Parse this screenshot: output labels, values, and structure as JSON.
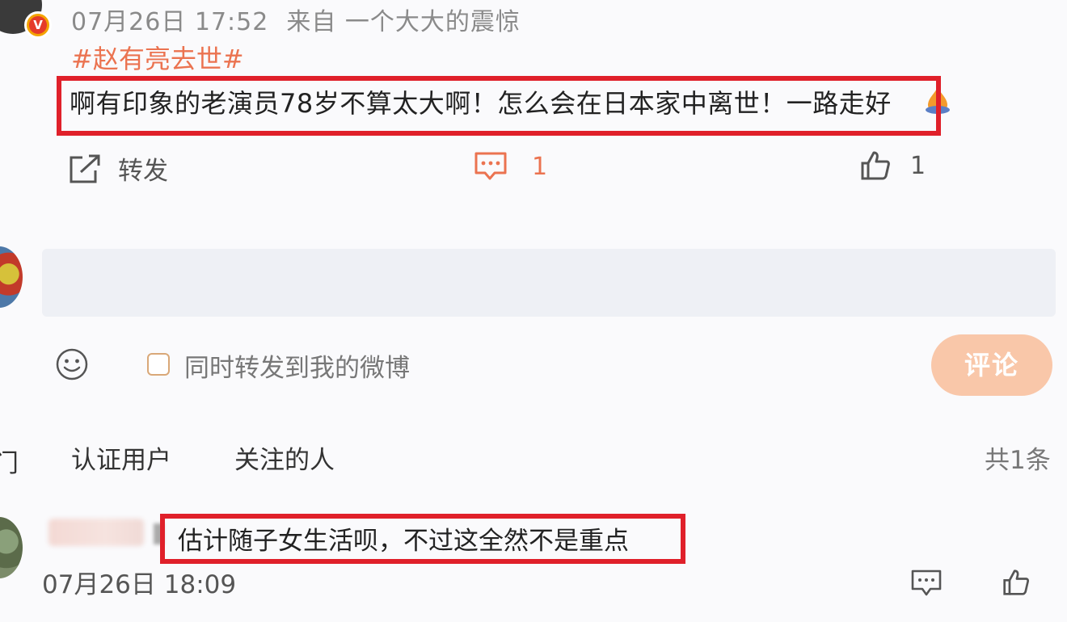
{
  "post": {
    "timestamp": "07月26日 17:52",
    "source": "来自 一个大大的震惊",
    "hashtag": "#赵有亮去世#",
    "text": "啊有印象的老演员78岁不算太大啊！怎么会在日本家中离世！一路走好",
    "verified_badge": "V",
    "emoji_icon": "candle-drop-icon"
  },
  "actions": {
    "repost_label": "转发",
    "comment_count": "1",
    "like_count": "1"
  },
  "composer": {
    "input_value": "",
    "sync_label": "同时转发到我的微博",
    "submit_label": "评论"
  },
  "filters": {
    "cut_tab": "门",
    "verified_tab": "认证用户",
    "following_tab": "关注的人",
    "total": "共1条"
  },
  "reply": {
    "text": "估计随子女生活呗，不过这全然不是重点",
    "timestamp": "07月26日 18:09"
  },
  "colors": {
    "accent_orange": "#eb7350",
    "highlight_red": "#e0202a",
    "submit_disabled": "#f9c7a9",
    "input_bg": "#eef0f5"
  }
}
